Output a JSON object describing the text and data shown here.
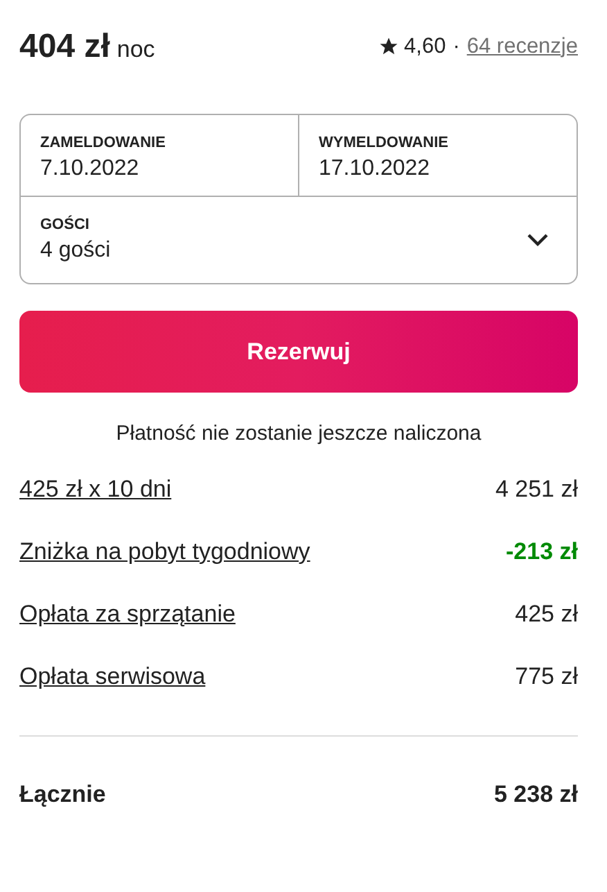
{
  "price": {
    "amount": "404 zł",
    "unit": "noc"
  },
  "rating": {
    "score": "4,60",
    "separator": "·",
    "reviews": "64 recenzje"
  },
  "booking": {
    "checkin": {
      "label": "ZAMELDOWANIE",
      "value": "7.10.2022"
    },
    "checkout": {
      "label": "WYMELDOWANIE",
      "value": "17.10.2022"
    },
    "guests": {
      "label": "GOŚCI",
      "value": "4 gości"
    }
  },
  "reserve_button": "Rezerwuj",
  "notice": "Płatność nie zostanie jeszcze naliczona",
  "fees": [
    {
      "label": "425 zł x 10 dni",
      "amount": "4 251 zł",
      "kind": "normal"
    },
    {
      "label": "Zniżka na pobyt tygodniowy",
      "amount": "-213 zł",
      "kind": "discount"
    },
    {
      "label": "Opłata za sprzątanie",
      "amount": "425 zł",
      "kind": "normal"
    },
    {
      "label": "Opłata serwisowa",
      "amount": "775 zł",
      "kind": "normal"
    }
  ],
  "total": {
    "label": "Łącznie",
    "amount": "5 238 zł"
  }
}
